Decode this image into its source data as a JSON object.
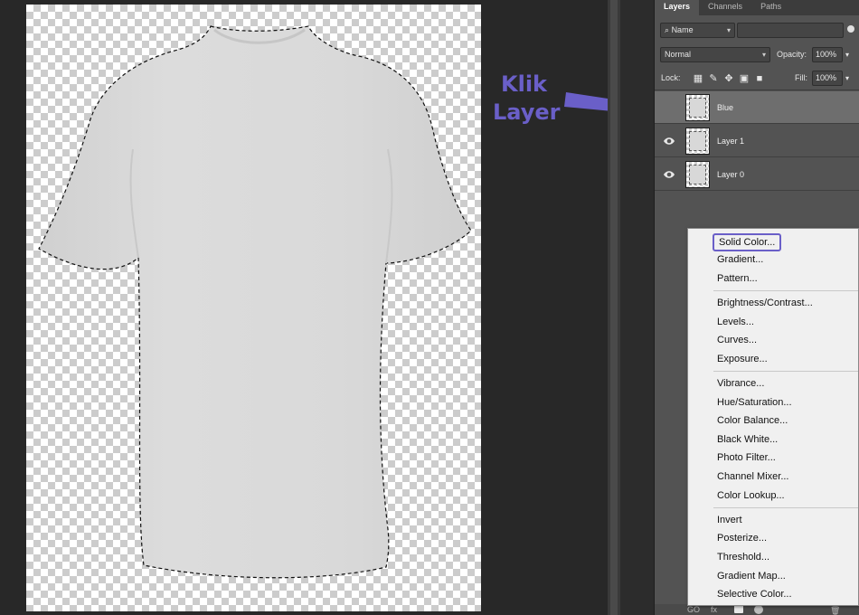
{
  "annotation": {
    "line1": "Klik",
    "line2": "Layer",
    "color": "#6a5fc8"
  },
  "panel": {
    "tabs": [
      {
        "label": "Layers",
        "active": true
      },
      {
        "label": "Channels",
        "active": false
      },
      {
        "label": "Paths",
        "active": false
      }
    ],
    "filter": {
      "kind": "Name",
      "icon": "search-icon"
    },
    "blend_mode": "Normal",
    "opacity_label": "Opacity:",
    "opacity_value": "100%",
    "lock_label": "Lock:",
    "fill_label": "Fill:",
    "fill_value": "100%",
    "layers": [
      {
        "name": "Blue",
        "visible": false,
        "selected": true
      },
      {
        "name": "Layer 1",
        "visible": true,
        "selected": false
      },
      {
        "name": "Layer 0",
        "visible": true,
        "selected": false
      }
    ],
    "footer": {
      "go": "GO",
      "fx": "fx"
    }
  },
  "menu": {
    "items": [
      "Solid Color...",
      "Gradient...",
      "Pattern...",
      "Brightness/Contrast...",
      "Levels...",
      "Curves...",
      "Exposure...",
      "Vibrance...",
      "Hue/Saturation...",
      "Color Balance...",
      "Black  White...",
      "Photo Filter...",
      "Channel Mixer...",
      "Color Lookup...",
      "Invert",
      "Posterize...",
      "Threshold...",
      "Gradient Map...",
      "Selective Color..."
    ],
    "highlighted": "Solid Color..."
  }
}
